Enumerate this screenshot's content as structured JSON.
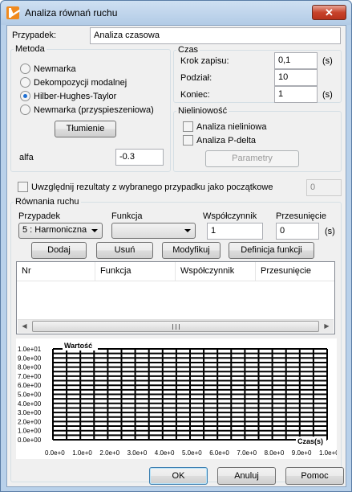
{
  "window": {
    "title": "Analiza równań ruchu",
    "close_glyph": "✕"
  },
  "case": {
    "label": "Przypadek:",
    "value": "Analiza czasowa"
  },
  "method": {
    "title": "Metoda",
    "options": [
      "Newmarka",
      "Dekompozycji modalnej",
      "Hilber-Hughes-Taylor",
      "Newmarka (przyspieszeniowa)"
    ],
    "selected_index": 2,
    "damping_button": "Tłumienie",
    "alfa_label": "alfa",
    "alfa_value": "-0.3"
  },
  "time": {
    "title": "Czas",
    "step_label": "Krok zapisu:",
    "step_value": "0,1",
    "step_unit": "(s)",
    "division_label": "Podział:",
    "division_value": "10",
    "end_label": "Koniec:",
    "end_value": "1",
    "end_unit": "(s)"
  },
  "nonlinearity": {
    "title": "Nieliniowość",
    "nonlinear_label": "Analiza nieliniowa",
    "pdelta_label": "Analiza P-delta",
    "params_button": "Parametry"
  },
  "initial": {
    "label": "Uwzględnij rezultaty z wybranego przypadku jako początkowe",
    "value": "0"
  },
  "equations": {
    "title": "Równania ruchu",
    "case_label": "Przypadek",
    "case_value": "5 : Harmoniczna",
    "function_label": "Funkcja",
    "function_value": "",
    "coef_label": "Współczynnik",
    "coef_value": "1",
    "shift_label": "Przesunięcie",
    "shift_value": "0",
    "shift_unit": "(s)",
    "buttons": {
      "add": "Dodaj",
      "remove": "Usuń",
      "modify": "Modyfikuj",
      "define": "Definicja funkcji"
    },
    "columns": [
      "Nr",
      "Funkcja",
      "Współczynnik",
      "Przesunięcie"
    ]
  },
  "chart_data": {
    "type": "line",
    "ylabel": "Wartość",
    "xlabel": "Czas(s)",
    "x_ticks": [
      "0.0e+0",
      "1.0e+0",
      "2.0e+0",
      "3.0e+0",
      "4.0e+0",
      "5.0e+0",
      "6.0e+0",
      "7.0e+0",
      "8.0e+0",
      "9.0e+0",
      "1.0e+01"
    ],
    "y_ticks": [
      "1.0e+01",
      "9.0e+00",
      "8.0e+00",
      "7.0e+00",
      "6.0e+00",
      "5.0e+00",
      "4.0e+00",
      "3.0e+00",
      "2.0e+00",
      "1.0e+00",
      "0.0e+00"
    ],
    "xlim": [
      0,
      10
    ],
    "ylim": [
      0,
      10
    ],
    "grid": true,
    "series": []
  },
  "footer": {
    "ok": "OK",
    "cancel": "Anuluj",
    "help": "Pomoc"
  }
}
